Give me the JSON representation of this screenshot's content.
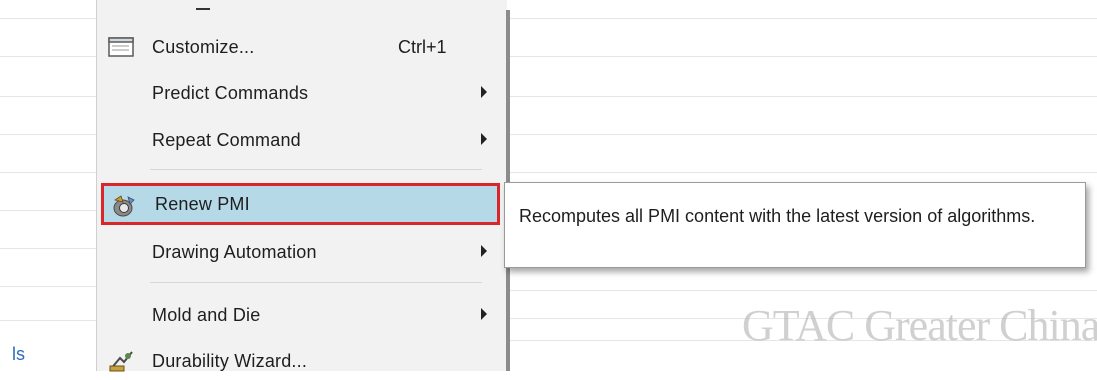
{
  "background": {
    "left_fragment": "ls"
  },
  "menu": {
    "items": [
      {
        "label": "Customize...",
        "shortcut": "Ctrl+1",
        "icon": "customize-window-icon",
        "submenu": false
      },
      {
        "label": "Predict Commands",
        "shortcut": "",
        "icon": "",
        "submenu": true
      },
      {
        "label": "Repeat Command",
        "shortcut": "",
        "icon": "",
        "submenu": true
      },
      {
        "label": "Renew PMI",
        "shortcut": "",
        "icon": "renew-pmi-icon",
        "submenu": false,
        "highlighted": true
      },
      {
        "label": "Drawing Automation",
        "shortcut": "",
        "icon": "",
        "submenu": true
      },
      {
        "label": "Mold and Die",
        "shortcut": "",
        "icon": "",
        "submenu": true
      },
      {
        "label": "Durability Wizard...",
        "shortcut": "",
        "icon": "durability-wizard-icon",
        "submenu": false
      }
    ]
  },
  "tooltip": {
    "text": "Recomputes all PMI content with the latest version of algorithms."
  },
  "watermark": "GTAC Greater China",
  "colors": {
    "highlight_bg": "#b6d9e8",
    "highlight_border": "#d8262b",
    "menu_bg": "#f2f2f2"
  }
}
